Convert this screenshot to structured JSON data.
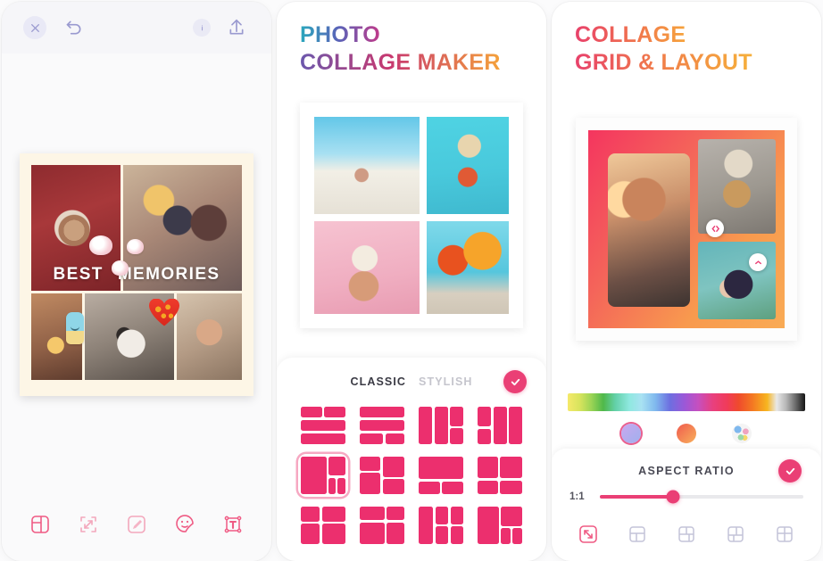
{
  "panel1": {
    "topbar": {
      "close_icon": "close-icon",
      "undo_icon": "undo-icon",
      "info_icon": "info-icon",
      "export_icon": "export-icon"
    },
    "collage": {
      "caption_word1": "BEST",
      "caption_word2": "MEMORIES",
      "frame_color": "#fdf6e6",
      "photos": [
        "coffee-cup-photo",
        "couple-hugging-photo",
        "lantern-photo",
        "dog-photo",
        "holding-hands-photo"
      ],
      "stickers": [
        "flower-sticker",
        "flower-sticker",
        "flower-sticker",
        "heart-sticker",
        "ice-cream-sticker"
      ]
    },
    "toolbar": [
      {
        "name": "layout-icon"
      },
      {
        "name": "resize-icon"
      },
      {
        "name": "eyedropper-icon"
      },
      {
        "name": "sticker-icon"
      },
      {
        "name": "text-icon"
      }
    ]
  },
  "panel2": {
    "title_line1": "PHOTO",
    "title_line2": "COLLAGE MAKER",
    "collage": {
      "photos": [
        "beach-couple-photo",
        "woman-sunglasses-photo",
        "ice-cream-cone-photo",
        "beach-umbrellas-photo"
      ]
    },
    "picker": {
      "tab_classic": "CLASSIC",
      "tab_stylish": "STYLISH",
      "confirm_icon": "check-icon",
      "accent_color": "#ec2f6e",
      "selected_index": 4,
      "layouts": [
        {
          "id": "layout-1",
          "rows": [
            "2",
            "1",
            "1"
          ]
        },
        {
          "id": "layout-2",
          "rows": [
            "1",
            "1",
            "2"
          ]
        },
        {
          "id": "layout-3",
          "cols": [
            "1",
            "1",
            "2"
          ]
        },
        {
          "id": "layout-4",
          "cols": [
            "2",
            "1",
            "1"
          ]
        },
        {
          "id": "layout-5",
          "desc": "big-left-two-right"
        },
        {
          "id": "layout-6",
          "desc": "left-stack-right-stack"
        },
        {
          "id": "layout-7",
          "desc": "one-top-two-bottom"
        },
        {
          "id": "layout-8",
          "desc": "two-top-two-bottom"
        },
        {
          "id": "layout-9",
          "desc": "two-top-one-bottom"
        },
        {
          "id": "layout-10",
          "desc": "three-cross"
        },
        {
          "id": "layout-11",
          "desc": "left-col-four-right"
        },
        {
          "id": "layout-12",
          "desc": "four-top-two-bottom"
        }
      ]
    }
  },
  "panel3": {
    "title_line1": "COLLAGE",
    "title_line2": "GRID & LAYOUT",
    "collage": {
      "background_gradient": [
        "#f4355f",
        "#f89a4e"
      ],
      "photos": [
        "smiling-girl-sunset-photo",
        "blonde-girl-beach-photo",
        "hands-holding-berries-photo"
      ],
      "handles": [
        "resize-handle",
        "resize-handle"
      ]
    },
    "colors": {
      "strip_name": "color-spectrum-strip",
      "options": [
        {
          "name": "solid-color-swatch",
          "selected": true
        },
        {
          "name": "gradient-swatch",
          "selected": false
        },
        {
          "name": "pattern-swatch",
          "selected": false
        }
      ]
    },
    "aspect": {
      "title": "ASPECT RATIO",
      "confirm_icon": "check-icon",
      "ratio_value": "1:1",
      "slider_percent": 36
    },
    "bottom_nav": [
      {
        "name": "crop-resize-icon",
        "active": true
      },
      {
        "name": "grid-layout-icon-1",
        "active": false
      },
      {
        "name": "grid-layout-icon-2",
        "active": false
      },
      {
        "name": "grid-layout-icon-3",
        "active": false
      },
      {
        "name": "grid-layout-icon-4",
        "active": false
      }
    ]
  }
}
